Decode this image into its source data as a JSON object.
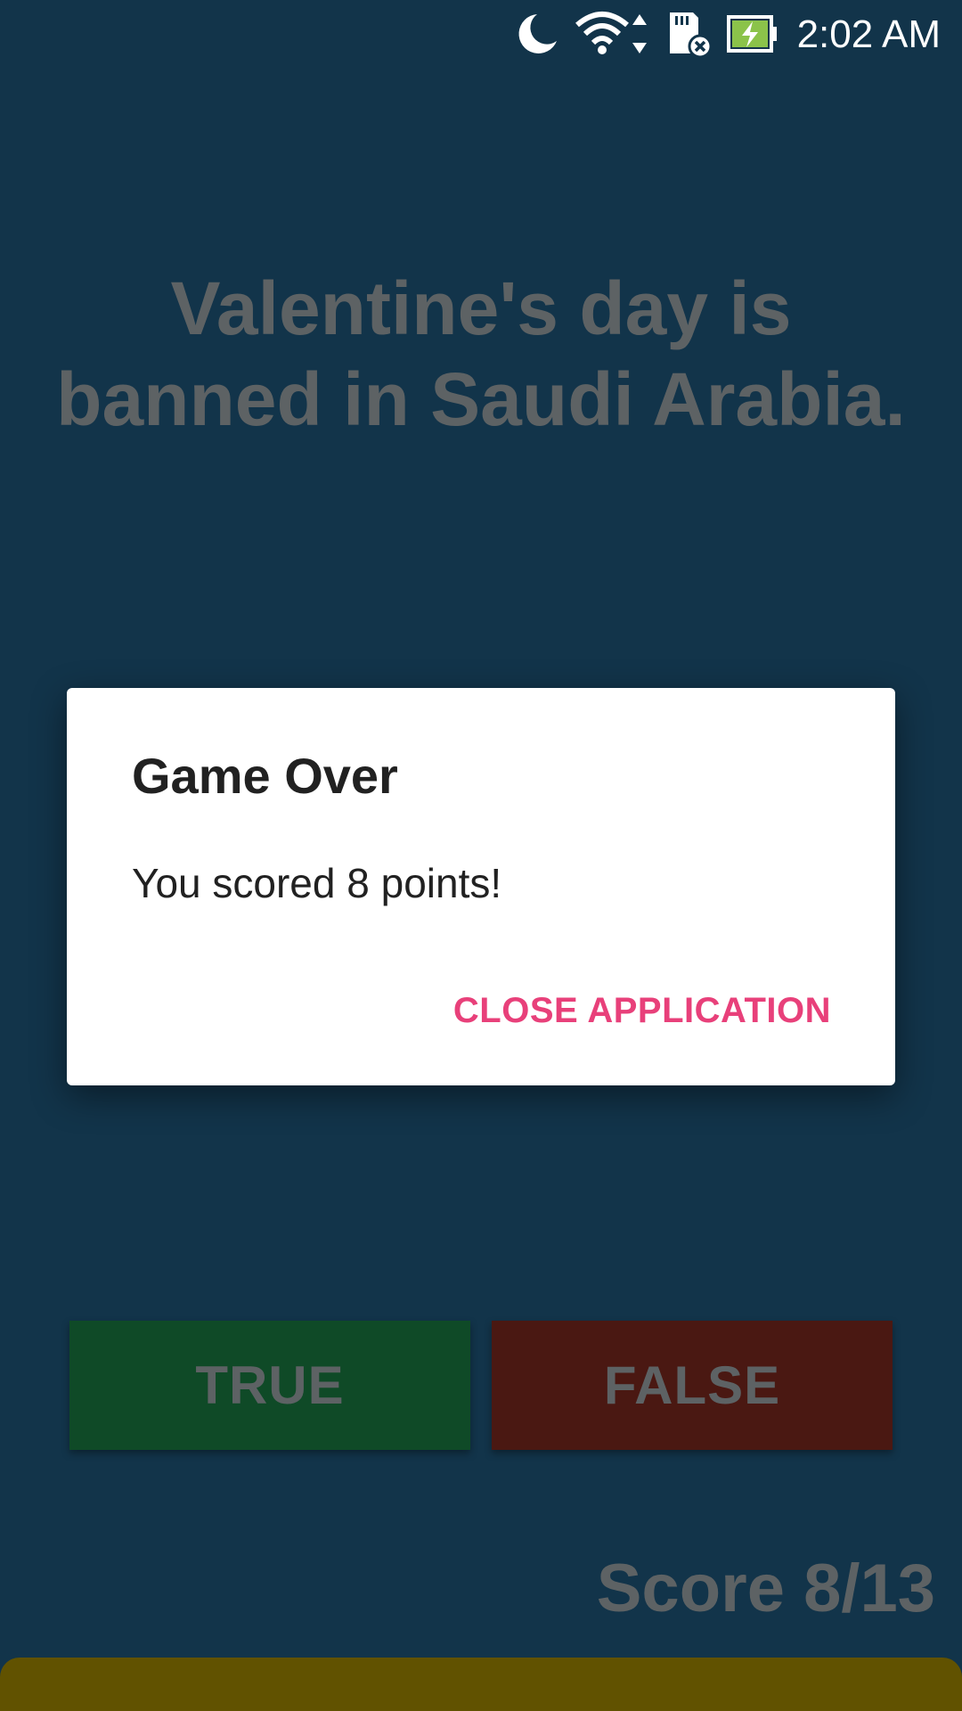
{
  "status_bar": {
    "time": "2:02 AM",
    "icons": [
      "moon-icon",
      "wifi-icon",
      "sd-card-icon",
      "battery-charging-icon"
    ]
  },
  "game": {
    "question": "Valentine's day is banned in Saudi Arabia.",
    "true_label": "TRUE",
    "false_label": "FALSE",
    "score_text": "Score 8/13",
    "progress_fraction": 1.0
  },
  "dialog": {
    "title": "Game Over",
    "message": "You scored 8 points!",
    "action_label": "CLOSE APPLICATION"
  },
  "colors": {
    "background": "#12344a",
    "true_button": "#0f4a27",
    "false_button": "#4a1812",
    "accent": "#e8407a",
    "progress": "#615200"
  }
}
